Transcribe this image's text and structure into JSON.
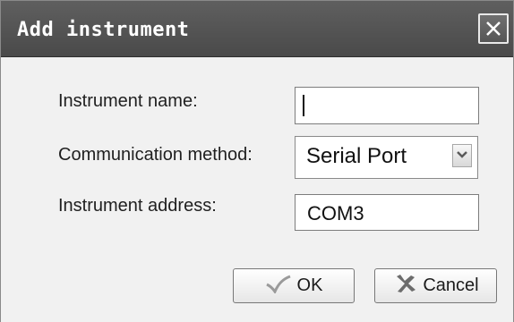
{
  "dialog": {
    "title": "Add instrument",
    "close_icon": "close-icon"
  },
  "form": {
    "name_label": "Instrument name:",
    "name_value": "",
    "method_label": "Communication method:",
    "method_value": "Serial Port",
    "address_label": "Instrument address:",
    "address_value": "COM3"
  },
  "buttons": {
    "ok_label": "OK",
    "ok_icon": "checkmark-icon",
    "cancel_label": "Cancel",
    "cancel_icon": "x-icon"
  },
  "colors": {
    "titlebar": "#555555",
    "background": "#f1f1f1"
  }
}
